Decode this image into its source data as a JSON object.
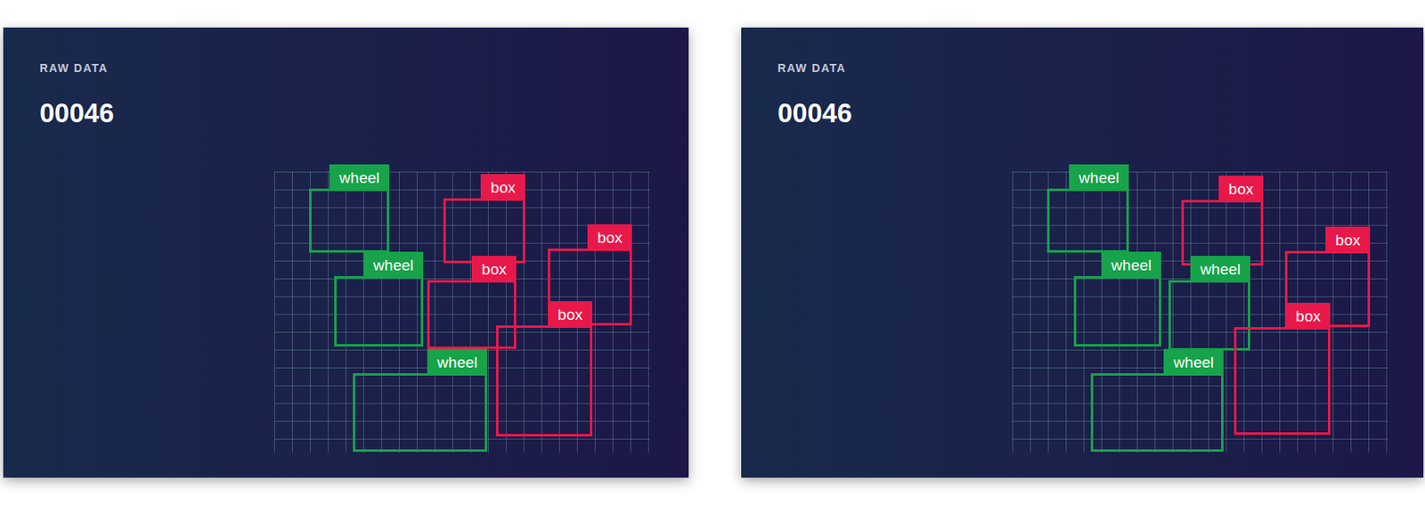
{
  "panels": [
    {
      "label": "RAW DATA",
      "sample": "00046",
      "annotations": [
        {
          "label": "wheel",
          "color": "#16a34a"
        },
        {
          "label": "box",
          "color": "#e8194a"
        },
        {
          "label": "box",
          "color": "#e8194a"
        },
        {
          "label": "wheel",
          "color": "#16a34a"
        },
        {
          "label": "box",
          "color": "#e8194a"
        },
        {
          "label": "box",
          "color": "#e8194a"
        },
        {
          "label": "wheel",
          "color": "#16a34a"
        }
      ]
    },
    {
      "label": "RAW DATA",
      "sample": "00046",
      "annotations": [
        {
          "label": "wheel",
          "color": "#16a34a"
        },
        {
          "label": "box",
          "color": "#e8194a"
        },
        {
          "label": "box",
          "color": "#e8194a"
        },
        {
          "label": "wheel",
          "color": "#16a34a"
        },
        {
          "label": "wheel",
          "color": "#16a34a"
        },
        {
          "label": "box",
          "color": "#e8194a"
        },
        {
          "label": "wheel",
          "color": "#16a34a"
        }
      ]
    }
  ]
}
